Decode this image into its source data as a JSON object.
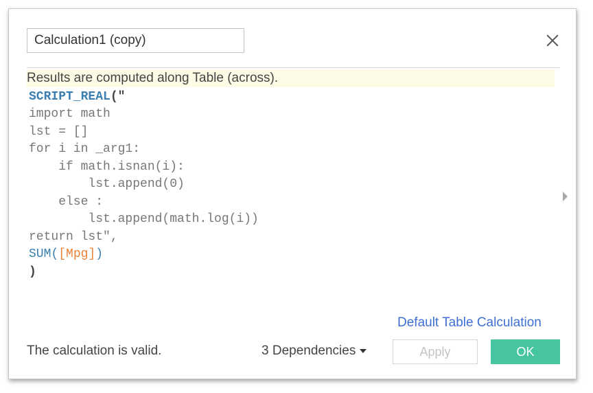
{
  "dialog": {
    "calc_name": "Calculation1 (copy)",
    "info_banner": "Results are computed along Table (across).",
    "code": {
      "line1_func": "SCRIPT_REAL",
      "line1_rest": "(\"",
      "line2": "import math",
      "line3": "lst = []",
      "line4": "for i in _arg1:",
      "line5": "    if math.isnan(i):",
      "line6": "        lst.append(0)",
      "line7": "    else :",
      "line8": "        lst.append(math.log(i))",
      "line9": "return lst\",",
      "line10_func": "SUM",
      "line10_open": "(",
      "line10_field": "[Mpg]",
      "line10_close": ")",
      "line11": ")"
    },
    "default_table_calc_link": "Default Table Calculation",
    "status_text": "The calculation is valid.",
    "dependencies_label": "3 Dependencies",
    "apply_label": "Apply",
    "ok_label": "OK"
  },
  "icons": {
    "close": "close-icon",
    "dependencies_caret": "caret-down-icon",
    "scroll": "scroll-right-arrow-icon"
  },
  "colors": {
    "accent_ok": "#47c4a0",
    "link": "#3d6fd6",
    "function": "#3a7fb0",
    "field": "#e8843a",
    "banner_bg": "#fdfbe6"
  }
}
